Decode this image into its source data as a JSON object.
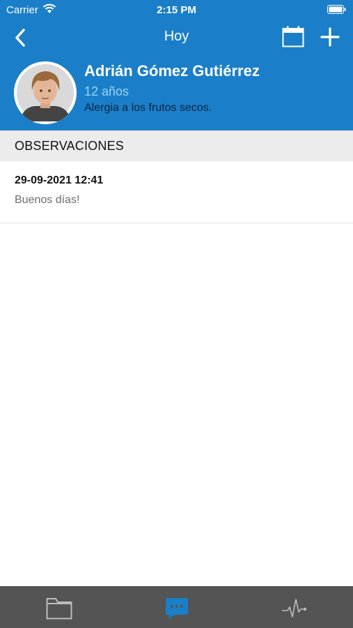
{
  "status_bar": {
    "carrier": "Carrier",
    "time": "2:15 PM"
  },
  "nav": {
    "title": "Hoy"
  },
  "patient": {
    "name": "Adrián Gómez Gutiérrez",
    "age": "12 años",
    "note": "Alergia a los frutos secos."
  },
  "section": {
    "title": "OBSERVACIONES"
  },
  "observations": [
    {
      "date": "29-09-2021 12:41",
      "text": "Buenos días!"
    }
  ],
  "tabs": [
    {
      "icon": "folder-icon",
      "active": false
    },
    {
      "icon": "chat-bubble-icon",
      "active": true
    },
    {
      "icon": "heartbeat-icon",
      "active": false
    }
  ],
  "colors": {
    "header_bg": "#1a7fc8",
    "age_text": "#9fd1f5",
    "tab_bar_bg": "#545454",
    "tab_active": "#1a7fc8"
  }
}
